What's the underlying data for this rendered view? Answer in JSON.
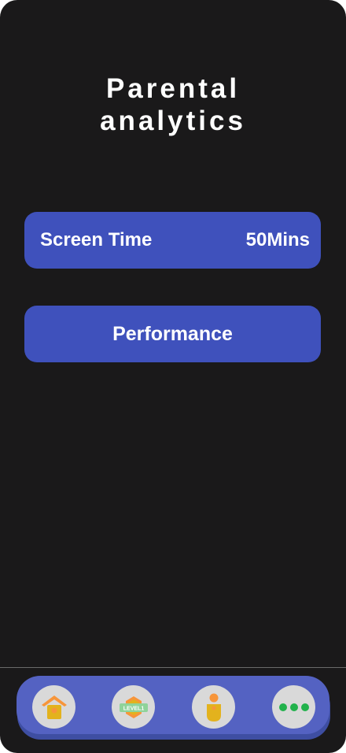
{
  "page": {
    "title_line1": "Parental",
    "title_line2": "analytics"
  },
  "cards": {
    "screen_time_label": "Screen Time",
    "screen_time_value": "50Mins",
    "performance_label": "Performance"
  },
  "bottom_nav": {
    "items": [
      {
        "icon": "home-icon"
      },
      {
        "icon": "level-badge-icon",
        "badge_text": "LEVEL1"
      },
      {
        "icon": "person-icon"
      },
      {
        "icon": "more-dots-icon"
      }
    ]
  },
  "colors": {
    "background": "#1a191a",
    "card": "#3f51bc",
    "nav_bar": "#5462c2",
    "nav_button": "#d9d9d9",
    "accent_orange": "#f7953a",
    "accent_yellow": "#e3b21d",
    "accent_green": "#22b24c"
  }
}
